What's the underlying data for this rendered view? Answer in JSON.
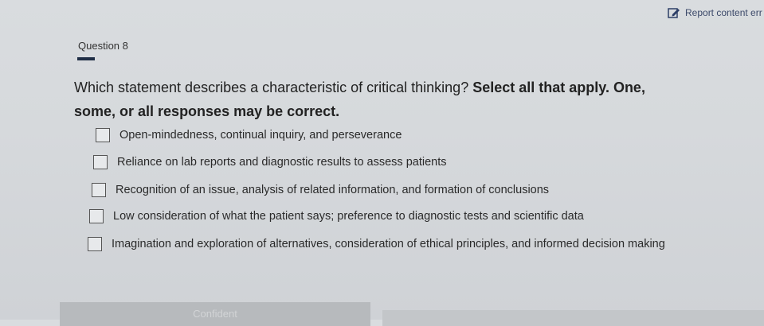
{
  "header": {
    "report_label": "Report content err"
  },
  "question": {
    "label": "Question 8",
    "stem_text": "Which statement describes a characteristic of critical thinking?",
    "instruction": "Select all that apply. One, some, or all responses may be correct."
  },
  "options": [
    {
      "text": "Open-mindedness, continual inquiry, and perseverance",
      "checked": false
    },
    {
      "text": "Reliance on lab reports and diagnostic results to assess patients",
      "checked": false
    },
    {
      "text": "Recognition of an issue, analysis of related information, and formation of conclusions",
      "checked": false
    },
    {
      "text": "Low consideration of what the patient says; preference to diagnostic tests and scientific data",
      "checked": false
    },
    {
      "text": "Imagination and exploration of alternatives, consideration of ethical principles, and informed decision making",
      "checked": false
    }
  ],
  "footer": {
    "left_label": "Confident"
  }
}
